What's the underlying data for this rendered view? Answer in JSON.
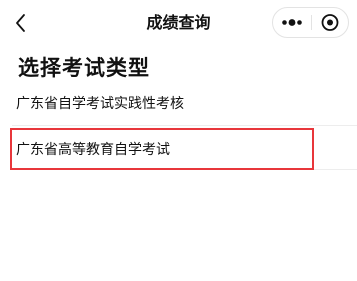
{
  "nav": {
    "title": "成绩查询",
    "back_icon": "chevron-left-icon",
    "more_icon": "more-dots-icon",
    "close_icon": "target-circle-icon"
  },
  "heading": "选择考试类型",
  "options": [
    {
      "label": "广东省自学考试实践性考核",
      "selected": false
    },
    {
      "label": "广东省高等教育自学考试",
      "selected": true
    }
  ],
  "colors": {
    "highlight": "#e8363b",
    "separator": "#ededed",
    "text": "#111111"
  }
}
